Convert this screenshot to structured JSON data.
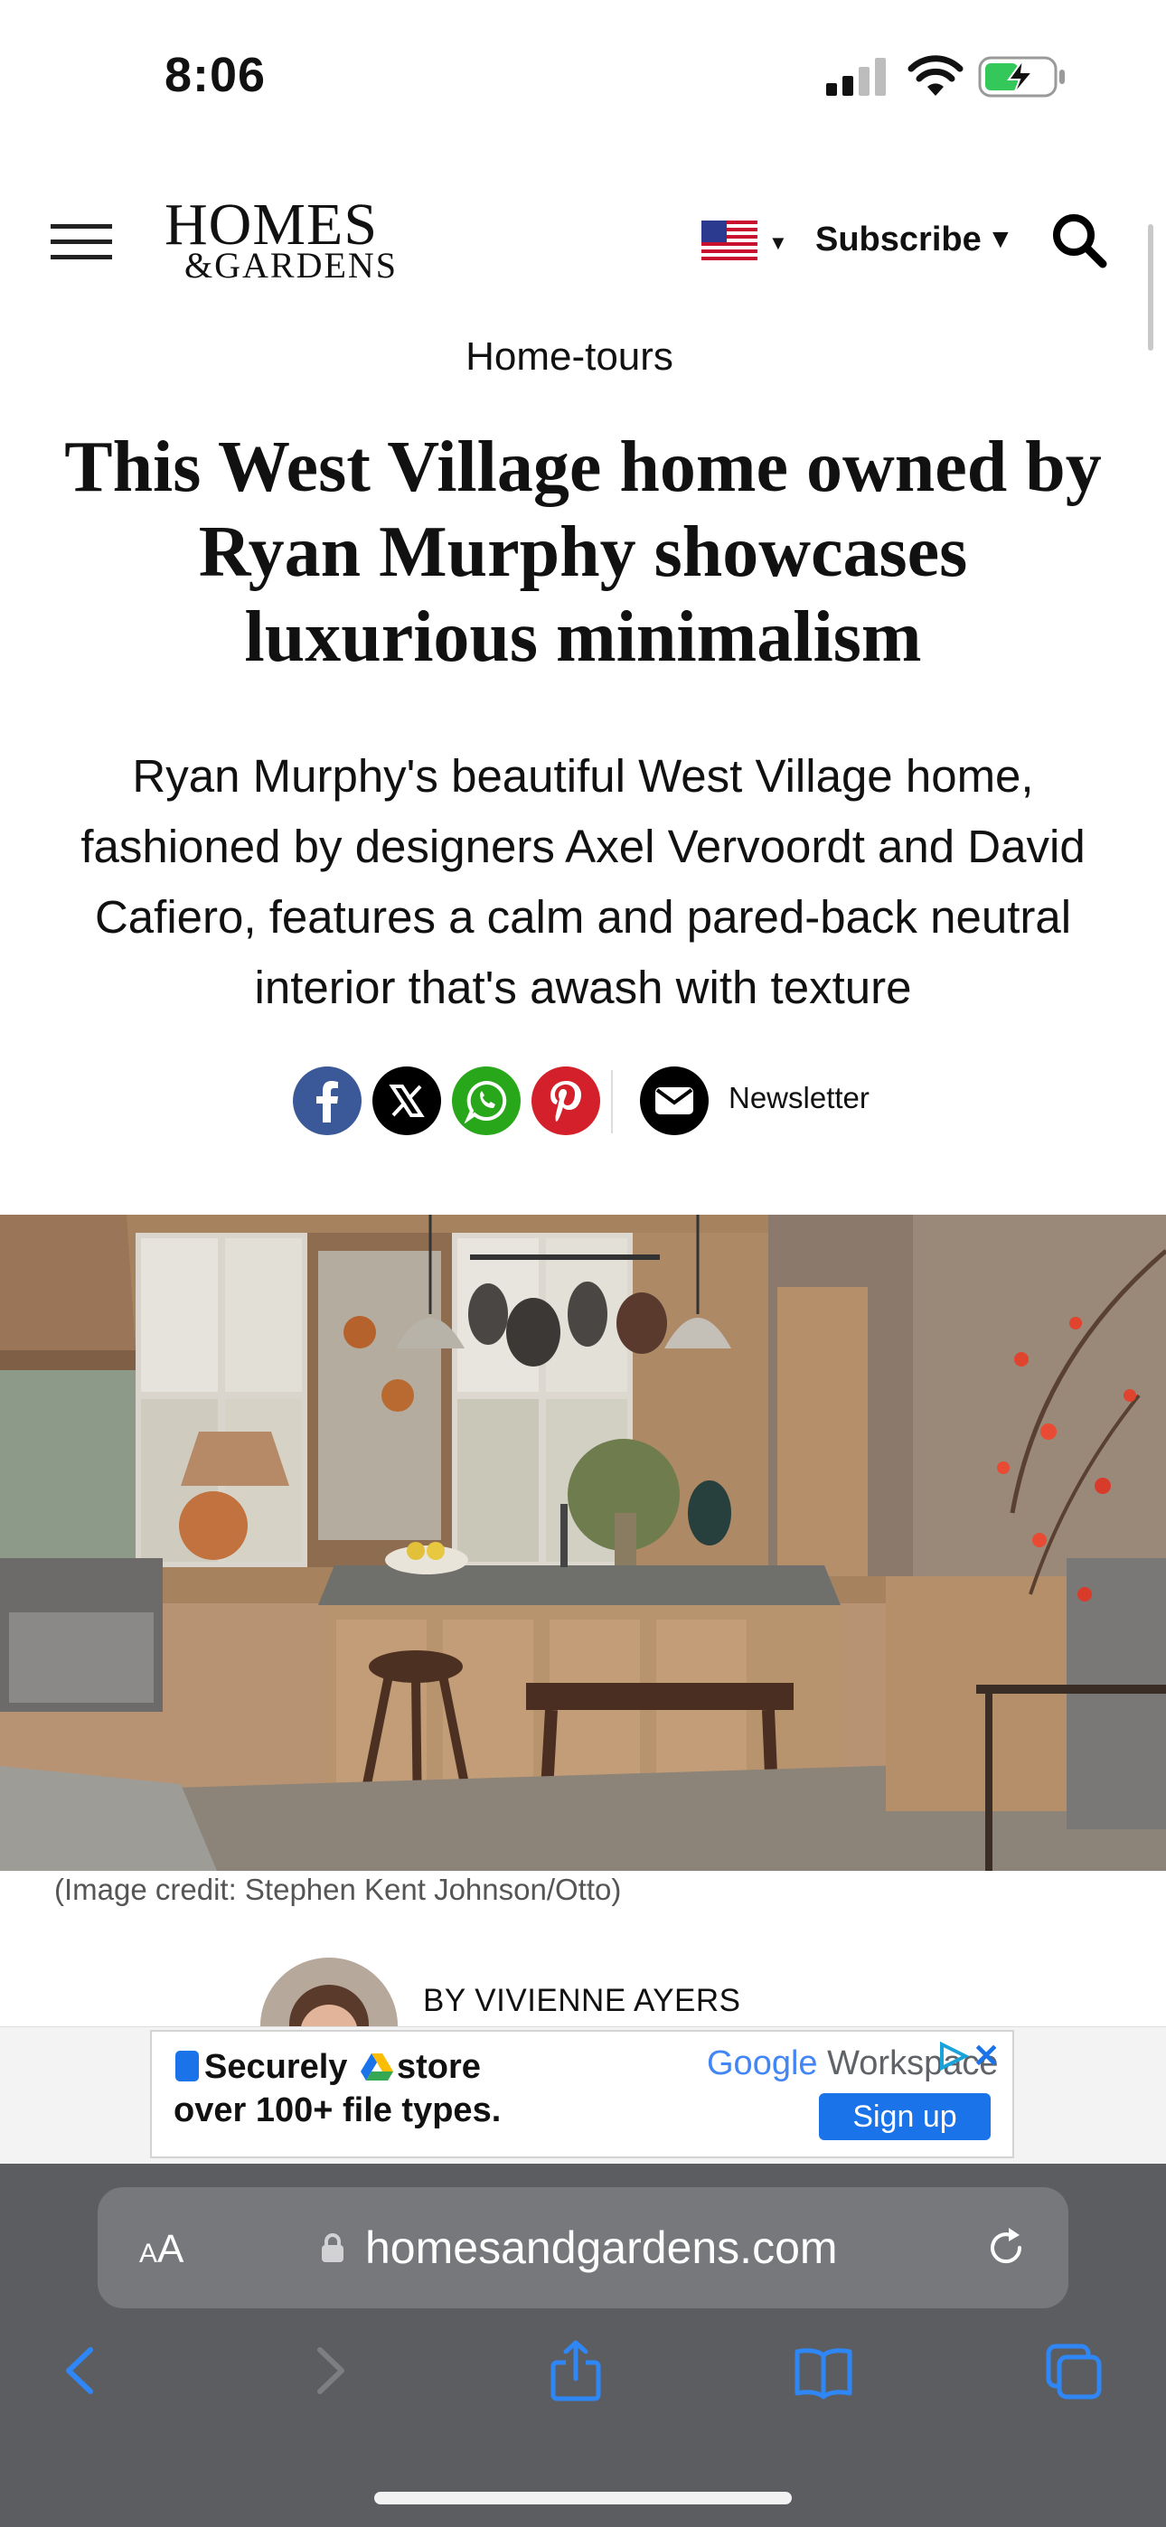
{
  "status_bar": {
    "time": "8:06"
  },
  "header": {
    "logo_line1": "HOMES",
    "logo_line2": "&GARDENS",
    "subscribe_label": "Subscribe",
    "region_flag": "us-flag-icon"
  },
  "article": {
    "category": "Home-tours",
    "headline": "This West Village home owned by Ryan Murphy showcases luxurious minimalism",
    "standfirst": "Ryan Murphy's beautiful West Village home, fashioned by designers Axel Vervoordt and David Cafiero, features a calm and pared-back neutral interior that's awash with texture",
    "share": {
      "icons": [
        "facebook-icon",
        "x-icon",
        "whatsapp-icon",
        "pinterest-icon",
        "mail-icon"
      ],
      "newsletter_label": "Newsletter"
    },
    "image_credit": "(Image credit: Stephen Kent Johnson/Otto)",
    "byline": "BY VIVIENNE AYERS"
  },
  "ad": {
    "line1_prefix": "Securely",
    "line1_suffix": "store",
    "line2": "over 100+ file types.",
    "brand_google": "Google",
    "brand_product": " Workspace",
    "cta": "Sign up"
  },
  "browser": {
    "text_size_label": "AA",
    "url": "homesandgardens.com"
  },
  "colors": {
    "facebook": "#3b5998",
    "whatsapp": "#29a71a",
    "pinterest": "#d4202a",
    "ad_cta": "#1a73e8",
    "toolbar_icon": "#2f86f5",
    "safari_bg": "#5c5d61"
  }
}
